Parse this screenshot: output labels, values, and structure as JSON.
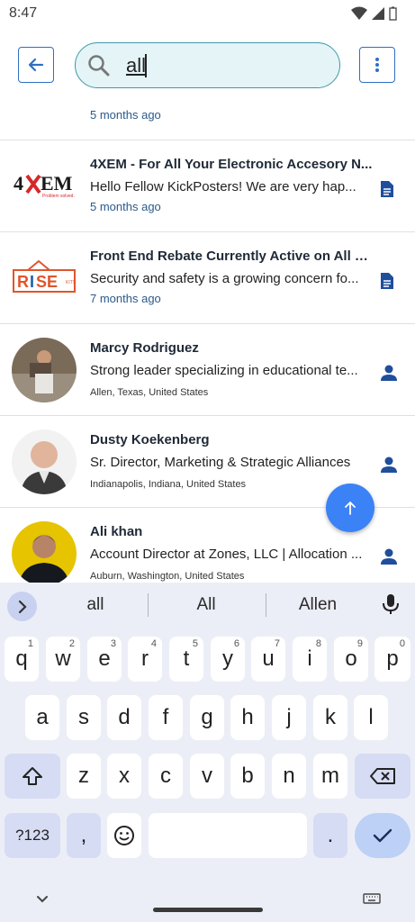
{
  "status": {
    "time": "8:47"
  },
  "search": {
    "value": "all"
  },
  "partial_row": {
    "meta": "5 months ago"
  },
  "results": [
    {
      "type": "post",
      "logo": "4XEM",
      "title": "4XEM - For All Your Electronic Accesory N...",
      "desc": "Hello Fellow KickPosters! We are very hap...",
      "meta": "5 months ago",
      "icon": "document-icon"
    },
    {
      "type": "post",
      "logo": "RISE",
      "title": "Front End Rebate Currently Active on All C...",
      "desc": "Security and safety is a growing concern fo...",
      "meta": "7 months ago",
      "icon": "document-icon"
    },
    {
      "type": "person",
      "title": "Marcy Rodriguez",
      "desc": "Strong leader specializing in educational te...",
      "location": "Allen, Texas, United States",
      "icon": "person-icon"
    },
    {
      "type": "person",
      "title": "Dusty Koekenberg",
      "desc": "Sr. Director, Marketing & Strategic Alliances",
      "location": "Indianapolis, Indiana, United States",
      "icon": "person-icon"
    },
    {
      "type": "person",
      "title": "Ali khan",
      "desc": "Account Director at Zones, LLC | Allocation ...",
      "location": "Auburn, Washington, United States",
      "icon": "person-icon"
    }
  ],
  "keyboard": {
    "suggestions": [
      "all",
      "All",
      "Allen"
    ],
    "row1": [
      {
        "k": "q",
        "n": "1"
      },
      {
        "k": "w",
        "n": "2"
      },
      {
        "k": "e",
        "n": "3"
      },
      {
        "k": "r",
        "n": "4"
      },
      {
        "k": "t",
        "n": "5"
      },
      {
        "k": "y",
        "n": "6"
      },
      {
        "k": "u",
        "n": "7"
      },
      {
        "k": "i",
        "n": "8"
      },
      {
        "k": "o",
        "n": "9"
      },
      {
        "k": "p",
        "n": "0"
      }
    ],
    "row2": [
      "a",
      "s",
      "d",
      "f",
      "g",
      "h",
      "j",
      "k",
      "l"
    ],
    "row3": [
      "z",
      "x",
      "c",
      "v",
      "b",
      "n",
      "m"
    ],
    "symbols": "?123",
    "comma": ",",
    "period": "."
  },
  "colors": {
    "accent": "#2f6fc2",
    "search_bg": "#e4f4f7",
    "fab": "#3b82f6",
    "keyboard_bg": "#eceef7"
  }
}
